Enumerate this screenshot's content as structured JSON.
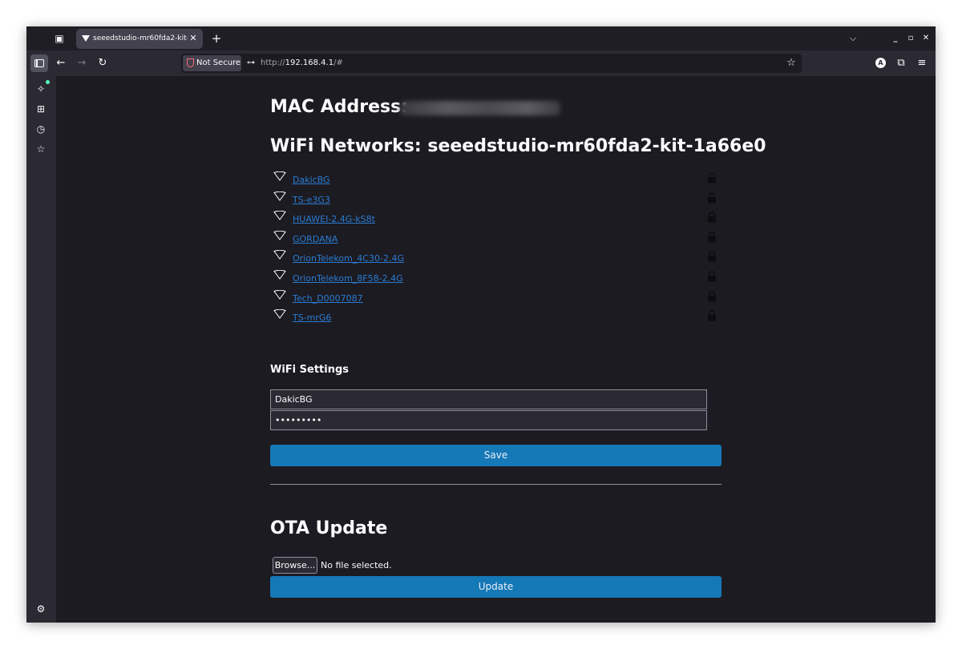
{
  "browser": {
    "tab_title": "seeedstudio-mr60fda2-kit-",
    "not_secure_label": "Not Secure",
    "url_scheme": "http://",
    "url_host": "192.168.4.1",
    "url_path": "/#"
  },
  "page": {
    "mac_heading": "MAC Address:",
    "wifi_heading": "WiFi Networks: seeedstudio-mr60fda2-kit-1a66e0",
    "networks": [
      {
        "ssid": "DakicBG"
      },
      {
        "ssid": "TS-e3G3"
      },
      {
        "ssid": "HUAWEI-2.4G-kS8t"
      },
      {
        "ssid": "GORDANA"
      },
      {
        "ssid": "OrionTelekom_4C30-2.4G"
      },
      {
        "ssid": "OrionTelekom_8F58-2.4G"
      },
      {
        "ssid": "Tech_D0007087"
      },
      {
        "ssid": "TS-mrG6"
      }
    ],
    "settings_heading": "WiFi Settings",
    "ssid_value": "DakicBG",
    "password_value": "•••••••••",
    "save_label": "Save",
    "ota_heading": "OTA Update",
    "browse_label": "Browse...",
    "file_status": "No file selected.",
    "update_label": "Update"
  },
  "colors": {
    "link": "#2a7bd1",
    "button": "#1578b7",
    "background": "#1c1b22"
  },
  "icons": {
    "network": "wifi-signal-icon",
    "secured": "lock-icon"
  }
}
